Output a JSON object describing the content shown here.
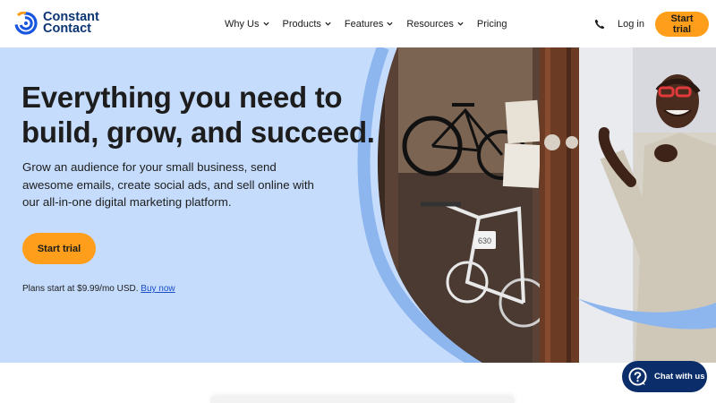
{
  "brand": {
    "line1": "Constant",
    "line2": "Contact"
  },
  "nav": {
    "items": [
      {
        "label": "Why Us",
        "has_dropdown": true
      },
      {
        "label": "Products",
        "has_dropdown": true
      },
      {
        "label": "Features",
        "has_dropdown": true
      },
      {
        "label": "Resources",
        "has_dropdown": true
      },
      {
        "label": "Pricing",
        "has_dropdown": false
      }
    ]
  },
  "header": {
    "phone_icon": "phone-icon",
    "login_label": "Log in",
    "cta_label": "Start trial"
  },
  "hero": {
    "headline": "Everything you need to build, grow, and succeed.",
    "subtext": "Grow an audience for your small business, send awesome emails, create social ads, and sell online with our all-in-one digital marketing platform.",
    "cta_label": "Start trial",
    "plans_text": "Plans start at $9.99/mo USD.",
    "plans_link": "Buy now",
    "price_tag": "630"
  },
  "chat": {
    "label": "Chat with us",
    "icon": "question-chat-icon"
  },
  "colors": {
    "hero_bg": "#c5dcfc",
    "cta": "#ff9e1b",
    "brand_navy": "#0b3573",
    "chat_bg": "#0b2e6b",
    "link": "#1b4fc9"
  }
}
